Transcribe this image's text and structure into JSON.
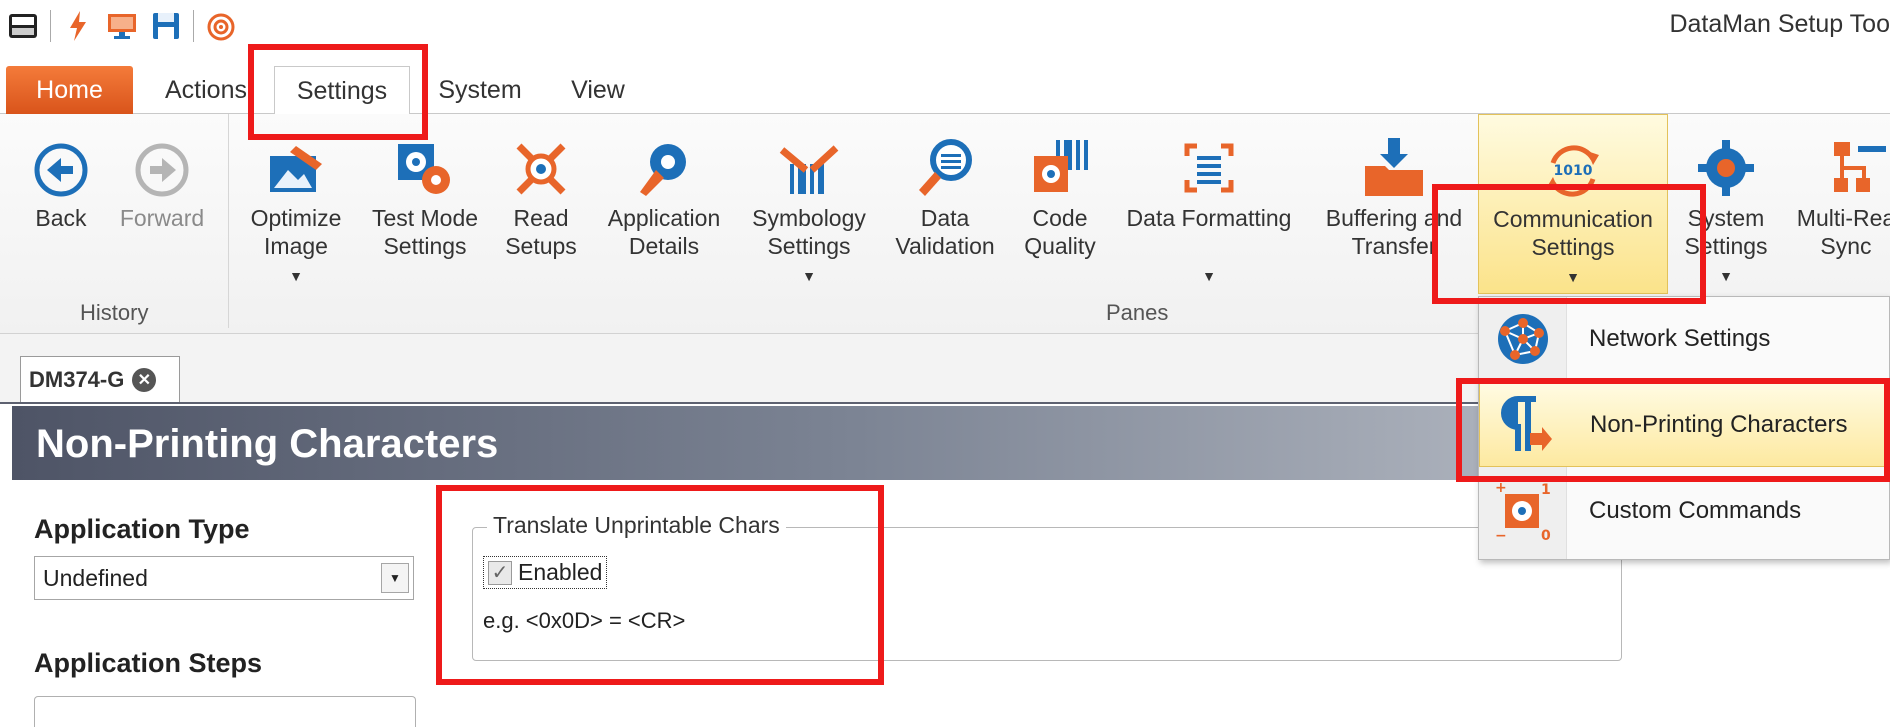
{
  "window": {
    "title": "DataMan Setup Too"
  },
  "quick_access": [
    "dataman-logo-icon",
    "lightning-icon",
    "monitor-icon",
    "save-icon",
    "target-icon"
  ],
  "tabs": [
    {
      "label": "Home"
    },
    {
      "label": "Actions"
    },
    {
      "label": "Settings"
    },
    {
      "label": "System"
    },
    {
      "label": "View"
    }
  ],
  "ribbon": {
    "history": {
      "label": "History",
      "back": "Back",
      "forward": "Forward"
    },
    "panes": {
      "label": "Panes",
      "optimize_image": "Optimize\nImage",
      "test_mode": "Test Mode\nSettings",
      "read_setups": "Read\nSetups",
      "app_details": "Application\nDetails",
      "symbology": "Symbology\nSettings",
      "data_validation": "Data\nValidation",
      "code_quality": "Code\nQuality",
      "data_formatting": "Data Formatting",
      "buffering": "Buffering and\nTransfer",
      "communication": "Communication\nSettings",
      "system_settings": "System\nSettings",
      "multi_reader": "Multi-Rea\nSync"
    }
  },
  "dropdown": {
    "items": [
      {
        "label": "Network Settings"
      },
      {
        "label": "Non-Printing Characters"
      },
      {
        "label": "Custom Commands"
      }
    ]
  },
  "doc_tab": {
    "label": "DM374-G"
  },
  "pane": {
    "title": "Non-Printing Characters",
    "app_type_label": "Application Type",
    "app_type_value": "Undefined",
    "app_steps_label": "Application Steps",
    "group": {
      "legend": "Translate Unprintable Chars",
      "checkbox_label": "Enabled",
      "checkbox_checked": true,
      "example": "e.g. <0x0D> = <CR>"
    }
  },
  "colors": {
    "home_tab": "#e8652a",
    "highlight": "#ee1a1a",
    "hover_fill": "#fde9a0",
    "icon_blue": "#1d6fb8",
    "icon_orange": "#e8652a"
  }
}
